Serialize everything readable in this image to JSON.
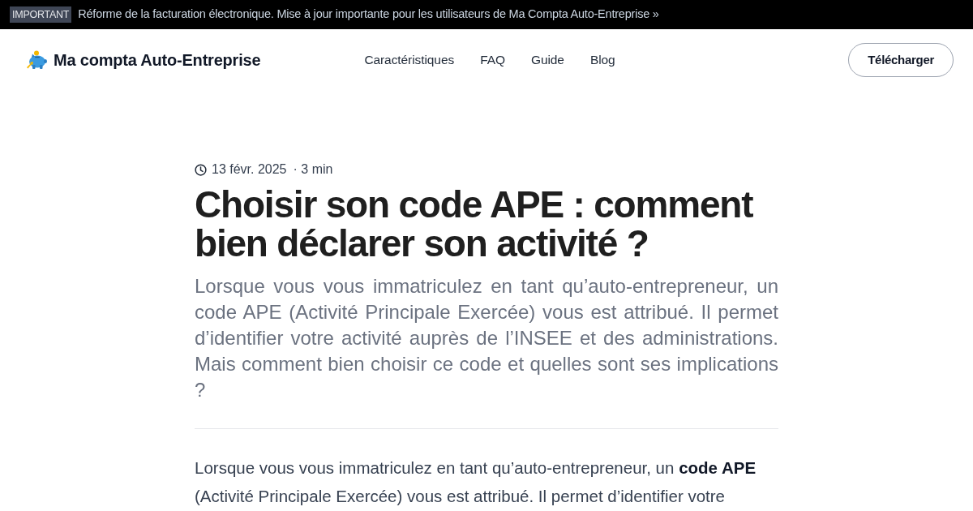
{
  "announcement": {
    "badge": "IMPORTANT",
    "text": "Réforme de la facturation électronique. Mise à jour importante pour les utilisateurs de Ma Compta Auto-Entreprise »"
  },
  "header": {
    "brand": "Ma compta Auto-Entreprise",
    "nav": [
      {
        "label": "Caractéristiques"
      },
      {
        "label": "FAQ"
      },
      {
        "label": "Guide"
      },
      {
        "label": "Blog"
      }
    ],
    "cta": "Télécharger"
  },
  "article": {
    "date": "13 févr. 2025",
    "reading_time": "· 3 min",
    "title": "Choisir son code APE : comment bien déclarer son activité ?",
    "lead": "Lorsque vous vous immatriculez en tant qu’auto-entrepreneur, un code APE (Activité Principale Exercée) vous est attribué. Il permet d’identifier votre activité auprès de l’INSEE et des administrations. Mais comment bien choisir ce code et quelles sont ses implications ?",
    "body": [
      "Lorsque vous vous immatriculez en tant qu’auto-entrepreneur, un **code APE** (Activité Principale Exercée) vous est attribué. Il permet d’identifier votre"
    ]
  }
}
